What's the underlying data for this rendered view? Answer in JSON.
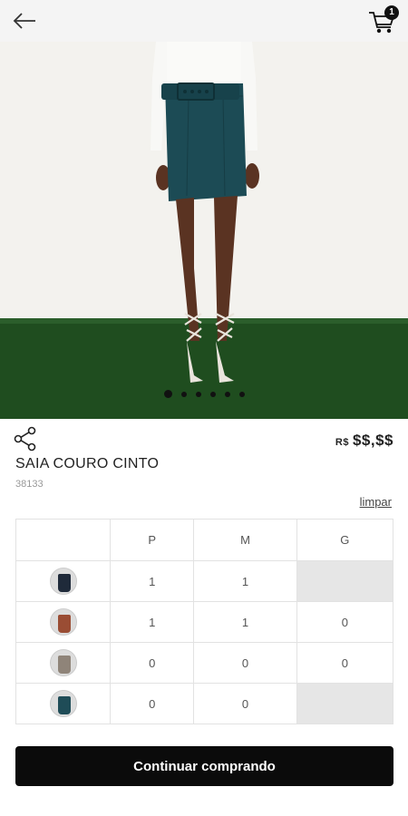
{
  "header": {
    "back_icon": "arrow-left-icon",
    "cart_icon": "shopping-cart-icon",
    "cart_count": "1"
  },
  "gallery": {
    "slides": 6,
    "active_index": 0
  },
  "product": {
    "share_icon": "share-icon",
    "price_currency": "R$",
    "price_value": "$$,$$",
    "name": "SAIA COURO CINTO",
    "code": "38133"
  },
  "grid": {
    "clear_label": "limpar",
    "sizes": [
      "P",
      "M",
      "G"
    ],
    "rows": [
      {
        "color_name": "navy",
        "swatch": "#1f2a3a",
        "cells": [
          "1",
          "1",
          null
        ]
      },
      {
        "color_name": "rust",
        "swatch": "#9a4d34",
        "cells": [
          "1",
          "1",
          "0"
        ]
      },
      {
        "color_name": "taupe",
        "swatch": "#8f8479",
        "cells": [
          "0",
          "0",
          "0"
        ]
      },
      {
        "color_name": "teal",
        "swatch": "#1f4c57",
        "cells": [
          "0",
          "0",
          null
        ]
      }
    ]
  },
  "cta": {
    "label": "Continuar comprando"
  },
  "colors": {
    "cta_background": "#0b0b0b",
    "disabled_cell": "#e6e6e6",
    "skirt": "#1c4b55",
    "grass": "#1f4d1f"
  }
}
